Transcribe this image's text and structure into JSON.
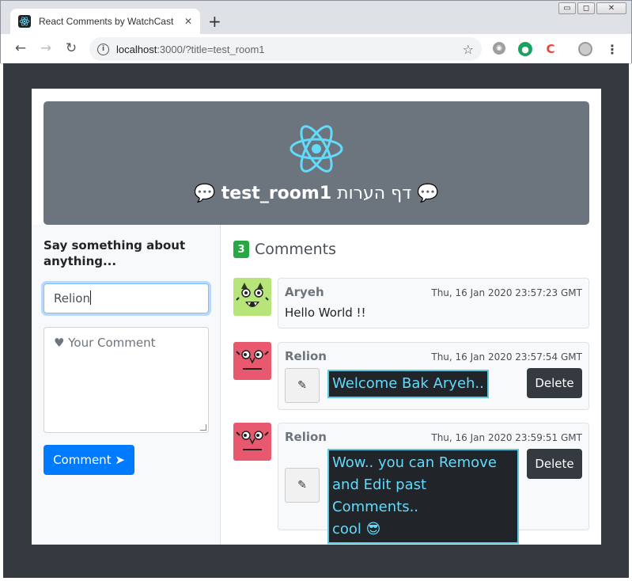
{
  "browser": {
    "tab_title": "React Comments by WatchCast",
    "tab_close": "✕",
    "new_tab": "+",
    "url_host": "localhost",
    "url_rest": ":3000/?title=test_room1",
    "window_buttons": [
      "▭",
      "◻",
      "✕"
    ]
  },
  "banner": {
    "title_prefix": "💬 ",
    "title_room": "test_room1",
    "title_hebrew": " דף הערות ",
    "title_suffix": "💬",
    "logo_color": "#61dafb",
    "background": "#6c757d"
  },
  "form": {
    "heading": "Say something about anything...",
    "name_value": "Relion",
    "comment_placeholder": "♥ Your Comment",
    "submit_label": "Comment ➤"
  },
  "comments_header": {
    "count": "3",
    "label": "Comments"
  },
  "comments": [
    {
      "author": "Aryeh",
      "time": "Thu, 16 Jan 2020 23:57:23 GMT",
      "text": "Hello World !!",
      "avatar": "green-monster-avatar",
      "editable": false
    },
    {
      "author": "Relion",
      "time": "Thu, 16 Jan 2020 23:57:54 GMT",
      "text": "Welcome Bak Aryeh..",
      "avatar": "pink-monster-avatar",
      "editable": true,
      "edit_icon": "✎",
      "delete_label": "Delete"
    },
    {
      "author": "Relion",
      "time": "Thu, 16 Jan 2020 23:59:51 GMT",
      "text_lines": [
        "Wow.. you can Remove",
        "and Edit past Comments..",
        "cool 😎"
      ],
      "avatar": "pink-monster-avatar",
      "editable": true,
      "edit_icon": "✎",
      "delete_label": "Delete"
    }
  ]
}
